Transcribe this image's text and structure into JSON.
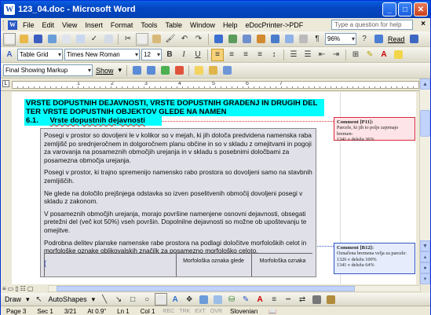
{
  "window": {
    "title": "123_04.doc - Microsoft Word"
  },
  "menu": {
    "items": [
      "File",
      "Edit",
      "View",
      "Insert",
      "Format",
      "Tools",
      "Table",
      "Window",
      "Help",
      "eDocPrinter->PDF"
    ],
    "help_placeholder": "Type a question for help"
  },
  "toolbar1": {
    "zoom": "96%",
    "read_label": "Read"
  },
  "toolbar2": {
    "style": "Table Grid",
    "font": "Times New Roman",
    "size": "12",
    "bold": "B",
    "italic": "I",
    "underline": "U"
  },
  "toolbar3": {
    "markup": "Final Showing Markup",
    "show_label": "Show"
  },
  "ruler": {
    "numbers": [
      "1",
      "2",
      "3",
      "4",
      "5",
      "6",
      "7"
    ]
  },
  "document": {
    "heading": "VRSTE DOPUSTNIH DEJAVNOSTI, VRSTE DOPUSTNIH GRADENJ IN DRUGIH DEL TER VRSTE DOPUSTNIH OBJEKTOV GLEDE NA NAMEN",
    "section_number": "6.1.",
    "section_title": "Vrste dopustnih dejavnosti",
    "paragraphs": [
      "Posegi v prostor so dovoljeni le v kolikor so v mejah, ki jih določa predvidena namenska raba zemljišč po srednjeročnem in dolgoročnem planu občine in so v skladu z omejitvami in pogoji za varovanja na posameznih območjih urejanja in v skladu s posebnimi določbami za posamezna območja urejanja.",
      "Posegi v prostor, ki trajno spremenijo namensko rabo prostora so dovoljeni samo na stavbnih zemljiščih.",
      "Ne glede na določilo prejšnjega odstavka so izven poselitvenih območij dovoljeni posegi v skladu z zakonom.",
      "V posameznih območjih urejanja, morajo površine namenjene osnovni dejavnosti, obsegati pretežni del (več kot 50%) vseh površin. Dopolnilne dejavnosti so možne ob upoštevanju te omejitve.",
      "Podrobna delitev planske namenske rabe prostora na podlagi določitve morfoloških celot in morfološke oznake oblikovalskih značilk za posamezno morfološko celoto."
    ],
    "empty_paragraph": "{",
    "table_headers": [
      "Morfološka oznaka glede",
      "Morfološka oznaka"
    ]
  },
  "comments": [
    {
      "title": "Comment [P11]:",
      "lines": [
        "Parcele, ki jih to polje zajemajo bremen-",
        "1341 v deležu 36%"
      ]
    },
    {
      "title": "Comment [B12]:",
      "lines": [
        "Označena bremena velja za parcele:",
        "1326 v deležu 100%",
        "1341 v deležu 64%"
      ]
    }
  ],
  "drawbar": {
    "draw_label": "Draw",
    "autoshapes_label": "AutoShapes"
  },
  "status": {
    "page": "Page 3",
    "sec": "Sec 1",
    "pages": "3/21",
    "at": "At 0.9\"",
    "ln": "Ln 1",
    "col": "Col 1",
    "rec": "REC",
    "trk": "TRK",
    "ext": "EXT",
    "ovr": "OVR",
    "language": "Slovenian"
  },
  "colors": {
    "highlight": "#00ffff",
    "comment_red": "#d9293c",
    "comment_blue": "#3356c4",
    "title_blue": "#0546c2"
  }
}
